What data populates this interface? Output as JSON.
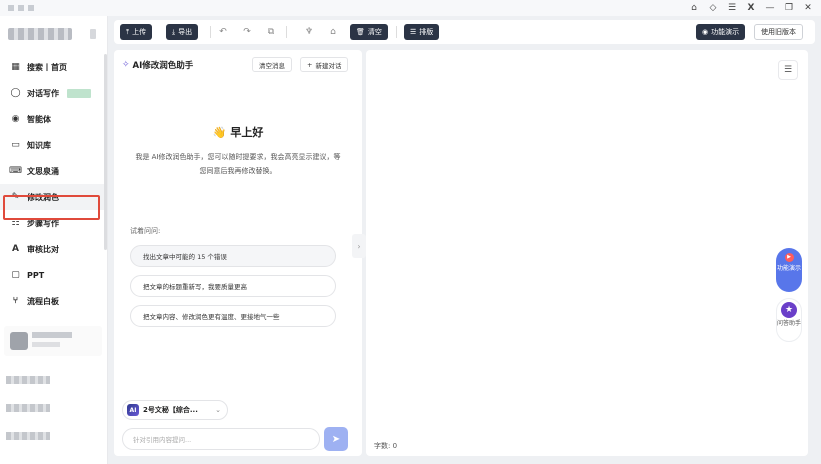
{
  "window": {
    "controls": [
      "⌂",
      "◇",
      "☰",
      "X",
      "—",
      "❐",
      "✕"
    ]
  },
  "sidebar": {
    "items": [
      {
        "icon": "grid-icon",
        "glyph": "▦",
        "label": "搜索丨首页"
      },
      {
        "icon": "chat-icon",
        "glyph": "◯",
        "label": "对话写作"
      },
      {
        "icon": "agent-icon",
        "glyph": "◉",
        "label": "智能体"
      },
      {
        "icon": "book-icon",
        "glyph": "▭",
        "label": "知识库"
      },
      {
        "icon": "keyboard-icon",
        "glyph": "⌨",
        "label": "文思泉涌"
      },
      {
        "icon": "pen-icon",
        "glyph": "✎",
        "label": "修改润色"
      },
      {
        "icon": "list-icon",
        "glyph": "☷",
        "label": "步骤写作"
      },
      {
        "icon": "compare-icon",
        "glyph": "A",
        "label": "审核比对"
      },
      {
        "icon": "ppt-icon",
        "glyph": "▢",
        "label": "PPT"
      },
      {
        "icon": "flow-icon",
        "glyph": "⑂",
        "label": "流程白板"
      }
    ],
    "active_index": 5
  },
  "toolbar": {
    "upload": "上传",
    "export": "导出",
    "clear": "清空",
    "layout": "排版",
    "demo": "功能演示",
    "old_version": "使用旧版本"
  },
  "assistant": {
    "title": "AI修改润色助手",
    "clear_messages": "清空消息",
    "new_chat": "新建对话",
    "greeting": "早上好",
    "intro": "我是 AI修改润色助手，您可以随时提要求，我会高亮显示建议，等您同意后我再修改替换。",
    "try_label": "试着问问:",
    "suggestions": [
      "找出文章中可能的 15 个错误",
      "把文章的标题重新写，我要质量更高",
      "把文章内容、修改润色更有温度、更接地气一些"
    ],
    "model": "2号文秘【综合...",
    "input_placeholder": "针对引用内容提问..."
  },
  "editor": {
    "word_count": "字数: 0"
  },
  "floating": {
    "demo": "功能演示",
    "help": "问答助手"
  }
}
